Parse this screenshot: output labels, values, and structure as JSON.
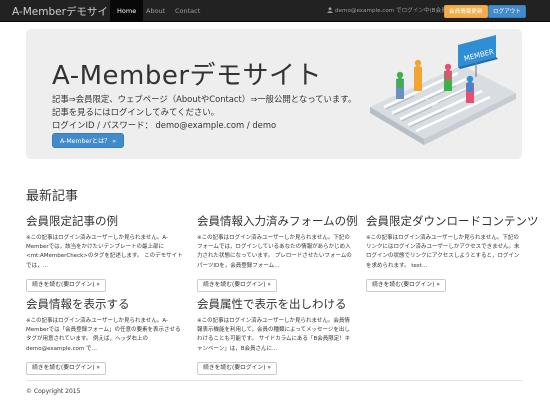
{
  "navbar": {
    "brand": "A-Memberデモサイト",
    "items": [
      {
        "label": "Home",
        "active": true
      },
      {
        "label": "About",
        "active": false
      },
      {
        "label": "Contact",
        "active": false
      }
    ],
    "user_status": "demo@example.com でログイン中(B会員)",
    "update_button": "会員情報更新",
    "logout_button": "ログアウト"
  },
  "jumbotron": {
    "title": "A-Memberデモサイト",
    "lines": [
      "記事⇒会員限定、ウェブページ（AboutやContact）⇒一般公開となっています。",
      "記事を見るにはログインしてみてください。",
      "ログインID / パスワード： demo@example.com / demo"
    ],
    "about_button": "A-Memberとは？ »",
    "illustration_sign": "MEMBER"
  },
  "articles_section": {
    "title": "最新記事",
    "read_more_label": "続きを読む(要ログイン) »",
    "items": [
      {
        "title": "会員限定記事の例",
        "excerpt": "※この記事はログイン済みユーザーしか見られません。A-Memberでは，該当をかけたいテンプレートの最上部に <mt:AMemberCheck>のタグを記述します。 このデモサイトでは，…"
      },
      {
        "title": "会員情報入力済みフォームの例",
        "excerpt": "※この記事はログイン済みユーザーしか見られません。下記のフォームでは，ログインしているあなたの情報があらかじめ入力された状態になっています。 プレロードさせたいフォームのパーツIDを，会員登録フォーム…"
      },
      {
        "title": "会員限定ダウンロードコンテンツ",
        "excerpt": "※この記事はログイン済みユーザーしか見られません。下記のリンクにはログイン済みユーザーしかアクセスできません。未ログインの状態でリンクにアクセスしようとすると，ログインを求められます。 test…"
      },
      {
        "title": "会員情報を表示する",
        "excerpt": "※この記事はログイン済みユーザーしか見られません。A-Memberでは「会員登録フォーム」の任意の要素を表示させるタグが用意されています。 例えば，ヘッダ右上の demo@example.com で…"
      },
      {
        "title": "会員属性で表示を出しわける",
        "excerpt": "※この記事はログイン済みユーザーしか見られません。会員情報表示機能を利用して，会員の種類によってメッセージを出しわけることも可能です。 サイドカラムにある「B会員限定！キャンペーン」は，B会員さんに…"
      }
    ]
  },
  "footer": {
    "copyright": "© Copyright 2015"
  }
}
